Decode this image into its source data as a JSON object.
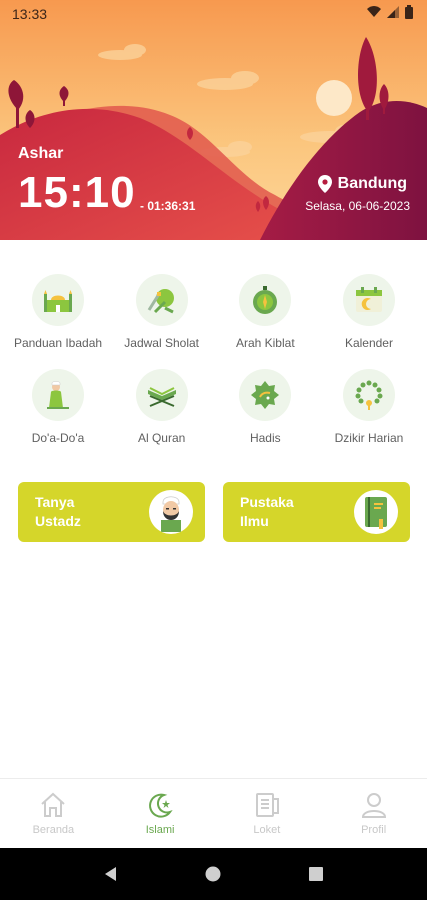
{
  "status_bar": {
    "time": "13:33"
  },
  "header": {
    "prayer_name": "Ashar",
    "prayer_time": "15:10",
    "countdown": "- 01:36:31",
    "location": "Bandung",
    "date": "Selasa, 06-06-2023"
  },
  "menu": [
    {
      "label": "Panduan Ibadah",
      "icon": "mosque-icon"
    },
    {
      "label": "Jadwal Sholat",
      "icon": "prayer-schedule-icon"
    },
    {
      "label": "Arah Kiblat",
      "icon": "compass-icon"
    },
    {
      "label": "Kalender",
      "icon": "calendar-icon"
    },
    {
      "label": "Do'a-Do'a",
      "icon": "praying-man-icon"
    },
    {
      "label": "Al Quran",
      "icon": "quran-icon"
    },
    {
      "label": "Hadis",
      "icon": "hadith-icon"
    },
    {
      "label": "Dzikir Harian",
      "icon": "prayer-beads-icon"
    }
  ],
  "cards": [
    {
      "label": "Tanya Ustadz",
      "icon": "ustadz-avatar-icon"
    },
    {
      "label": "Pustaka Ilmu",
      "icon": "book-icon"
    }
  ],
  "bottom_nav": [
    {
      "label": "Beranda",
      "icon": "home-icon",
      "active": false
    },
    {
      "label": "Islami",
      "icon": "crescent-star-icon",
      "active": true
    },
    {
      "label": "Loket",
      "icon": "ticket-icon",
      "active": false
    },
    {
      "label": "Profil",
      "icon": "user-icon",
      "active": false
    }
  ],
  "colors": {
    "accent_green": "#6aa84f",
    "card_yellow": "#d5d62a",
    "banner_sky": "#f7a85c",
    "banner_hill": "#b51d3f"
  }
}
